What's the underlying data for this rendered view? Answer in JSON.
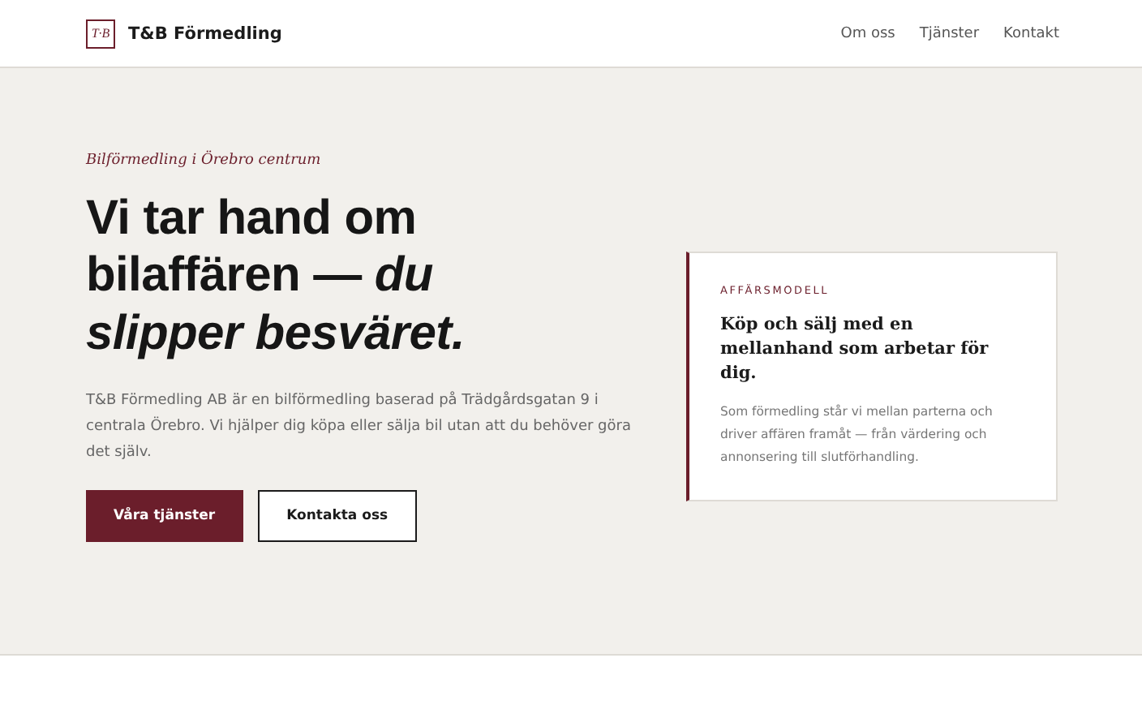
{
  "header": {
    "logo_mark": "T·B",
    "brand": "T&B Förmedling",
    "nav": [
      {
        "label": "Om oss"
      },
      {
        "label": "Tjänster"
      },
      {
        "label": "Kontakt"
      }
    ]
  },
  "hero": {
    "eyebrow": "Bilförmedling i Örebro centrum",
    "heading": "Vi tar hand om bilaffären — *du slipper besväret.*",
    "intro": "T&B Förmedling AB är en bilförmedling baserad på Trädgårdsgatan 9 i centrala Örebro. Vi hjälper dig köpa eller sälja bil utan att du behöver göra det själv.",
    "buttons": [
      {
        "label": "Våra tjänster",
        "kind": "primary"
      },
      {
        "label": "Kontakta oss",
        "kind": "secondary"
      }
    ]
  },
  "card": {
    "label": "AFFÄRSMODELL",
    "title": "Köp och sälj med en mellanhand som arbetar för dig.",
    "text": "Som förmedling står vi mellan parterna och driver affären framåt — från värdering och annonsering till slutförhandling."
  }
}
